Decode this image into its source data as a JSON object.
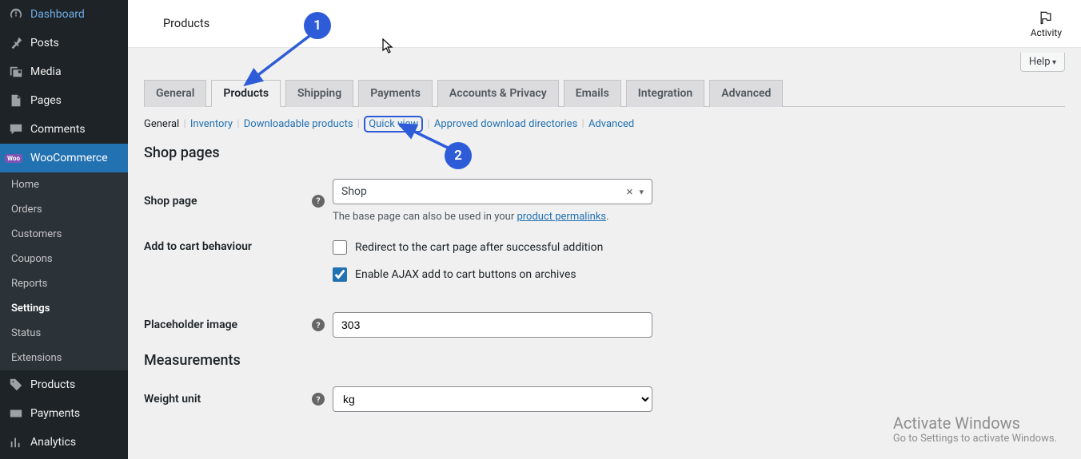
{
  "sidebar": {
    "items": [
      {
        "label": "Dashboard"
      },
      {
        "label": "Posts"
      },
      {
        "label": "Media"
      },
      {
        "label": "Pages"
      },
      {
        "label": "Comments"
      },
      {
        "label": "WooCommerce"
      },
      {
        "label": "Products"
      },
      {
        "label": "Payments"
      },
      {
        "label": "Analytics"
      }
    ],
    "sub": [
      {
        "label": "Home"
      },
      {
        "label": "Orders"
      },
      {
        "label": "Customers"
      },
      {
        "label": "Coupons"
      },
      {
        "label": "Reports"
      },
      {
        "label": "Settings"
      },
      {
        "label": "Status"
      },
      {
        "label": "Extensions"
      }
    ]
  },
  "topbar": {
    "title": "Products",
    "activity": "Activity"
  },
  "help_label": "Help",
  "tabs": [
    {
      "label": "General"
    },
    {
      "label": "Products"
    },
    {
      "label": "Shipping"
    },
    {
      "label": "Payments"
    },
    {
      "label": "Accounts & Privacy"
    },
    {
      "label": "Emails"
    },
    {
      "label": "Integration"
    },
    {
      "label": "Advanced"
    }
  ],
  "subtabs": {
    "current": "General",
    "links": [
      "Inventory",
      "Downloadable products",
      "Quick view",
      "Approved download directories",
      "Advanced"
    ]
  },
  "sections": {
    "shop_pages": "Shop pages",
    "measurements": "Measurements"
  },
  "form": {
    "shop_page_label": "Shop page",
    "shop_page_value": "Shop",
    "shop_page_hint_prefix": "The base page can also be used in your ",
    "shop_page_hint_link": "product permalinks",
    "shop_page_hint_suffix": ".",
    "add_to_cart_label": "Add to cart behaviour",
    "redirect_label": "Redirect to the cart page after successful addition",
    "ajax_label": "Enable AJAX add to cart buttons on archives",
    "redirect_checked": false,
    "ajax_checked": true,
    "placeholder_label": "Placeholder image",
    "placeholder_value": "303",
    "weight_label": "Weight unit",
    "weight_value": "kg"
  },
  "annotations": {
    "n1": "1",
    "n2": "2"
  },
  "watermark": {
    "line1": "Activate Windows",
    "line2": "Go to Settings to activate Windows."
  }
}
